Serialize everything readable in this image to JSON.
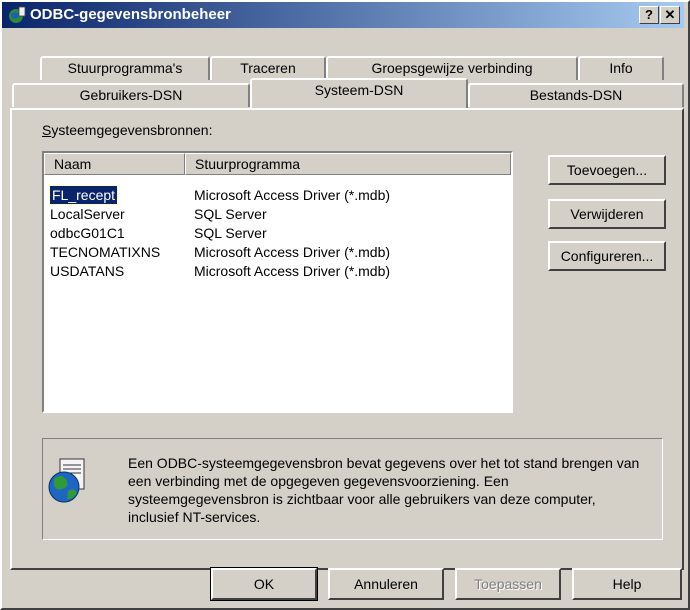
{
  "window": {
    "title": "ODBC-gegevensbronbeheer"
  },
  "titlebar_buttons": {
    "help": "?",
    "close": "✕"
  },
  "tabs_back": [
    "Stuurprogramma's",
    "Traceren",
    "Groepsgewijze verbinding",
    "Info"
  ],
  "tabs_front": [
    "Gebruikers-DSN",
    "Systeem-DSN",
    "Bestands-DSN"
  ],
  "active_tab": "Systeem-DSN",
  "list": {
    "label": "Systeemgegevensbronnen:",
    "columns": [
      "Naam",
      "Stuurprogramma"
    ],
    "rows": [
      {
        "name": "FL_recept",
        "driver": "Microsoft Access Driver (*.mdb)",
        "selected": true
      },
      {
        "name": "LocalServer",
        "driver": "SQL Server"
      },
      {
        "name": "odbcG01C1",
        "driver": "SQL Server"
      },
      {
        "name": "TECNOMATIXNS",
        "driver": "Microsoft Access Driver (*.mdb)"
      },
      {
        "name": "USDATANS",
        "driver": "Microsoft Access Driver (*.mdb)"
      }
    ]
  },
  "side_buttons": {
    "add": "Toevoegen...",
    "remove": "Verwijderen",
    "configure": "Configureren..."
  },
  "info": {
    "icon": "globe-database-icon",
    "text": "Een ODBC-systeemgegevensbron bevat gegevens over het tot stand brengen van een verbinding met de opgegeven gegevensvoorziening. Een systeemgegevensbron is zichtbaar voor alle gebruikers van deze computer, inclusief NT-services."
  },
  "bottom_buttons": {
    "ok": "OK",
    "cancel": "Annuleren",
    "apply": "Toepassen",
    "help": "Help"
  },
  "colors": {
    "titlebar_start": "#0a246a",
    "titlebar_end": "#a6caf0",
    "face": "#d4d0c8",
    "selection": "#0a246a"
  }
}
